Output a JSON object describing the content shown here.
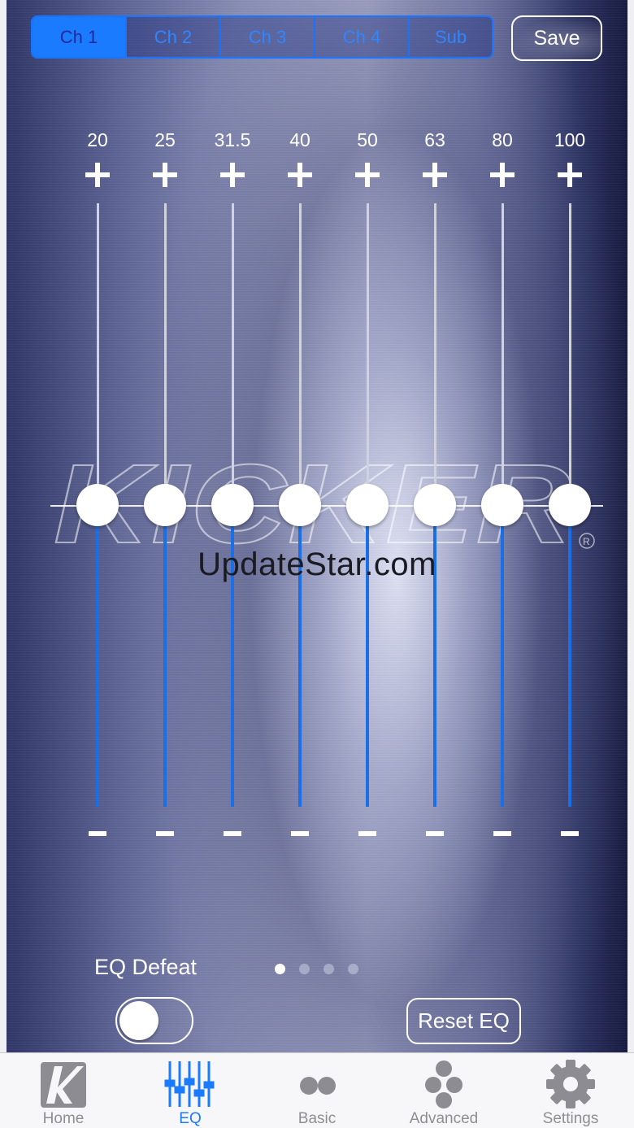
{
  "channel_tabs": [
    {
      "label": "Ch 1",
      "active": true
    },
    {
      "label": "Ch 2",
      "active": false
    },
    {
      "label": "Ch 3",
      "active": false
    },
    {
      "label": "Ch 4",
      "active": false
    },
    {
      "label": "Sub",
      "active": false
    }
  ],
  "save_label": "Save",
  "bands": [
    {
      "label": "20",
      "gain_fraction": 0.5
    },
    {
      "label": "25",
      "gain_fraction": 0.5
    },
    {
      "label": "31.5",
      "gain_fraction": 0.5
    },
    {
      "label": "40",
      "gain_fraction": 0.5
    },
    {
      "label": "50",
      "gain_fraction": 0.5
    },
    {
      "label": "63",
      "gain_fraction": 0.5
    },
    {
      "label": "80",
      "gain_fraction": 0.5
    },
    {
      "label": "100",
      "gain_fraction": 0.5
    }
  ],
  "brand": "KICKER",
  "watermark": "UpdateStar.com",
  "eq_defeat": {
    "label": "EQ Defeat",
    "on": false
  },
  "page_indicator": {
    "count": 4,
    "current": 1
  },
  "reset_label": "Reset EQ",
  "colors": {
    "accent": "#1b7bff",
    "track_active": "#1b6fe6",
    "tab_inactive": "#8e8e93"
  },
  "tab_bar": [
    {
      "label": "Home",
      "icon": "kicker-k-icon",
      "active": false
    },
    {
      "label": "EQ",
      "icon": "eq-sliders-icon",
      "active": true
    },
    {
      "label": "Basic",
      "icon": "two-dots-icon",
      "active": false
    },
    {
      "label": "Advanced",
      "icon": "four-dots-icon",
      "active": false
    },
    {
      "label": "Settings",
      "icon": "gear-icon",
      "active": false
    }
  ]
}
